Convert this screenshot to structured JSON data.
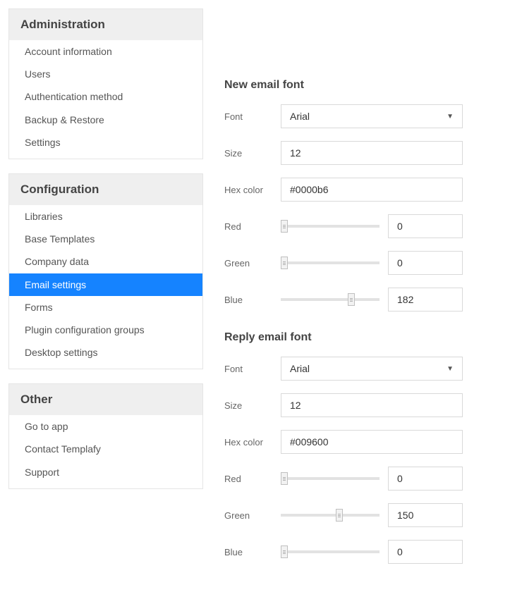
{
  "sidebar": {
    "groups": [
      {
        "header": "Administration",
        "items": [
          {
            "label": "Account information",
            "selected": false
          },
          {
            "label": "Users",
            "selected": false
          },
          {
            "label": "Authentication method",
            "selected": false
          },
          {
            "label": "Backup & Restore",
            "selected": false
          },
          {
            "label": "Settings",
            "selected": false
          }
        ]
      },
      {
        "header": "Configuration",
        "items": [
          {
            "label": "Libraries",
            "selected": false
          },
          {
            "label": "Base Templates",
            "selected": false
          },
          {
            "label": "Company data",
            "selected": false
          },
          {
            "label": "Email settings",
            "selected": true
          },
          {
            "label": "Forms",
            "selected": false
          },
          {
            "label": "Plugin configuration groups",
            "selected": false
          },
          {
            "label": "Desktop settings",
            "selected": false
          }
        ]
      },
      {
        "header": "Other",
        "items": [
          {
            "label": "Go to app",
            "selected": false
          },
          {
            "label": "Contact Templafy",
            "selected": false
          },
          {
            "label": "Support",
            "selected": false
          }
        ]
      }
    ]
  },
  "labels": {
    "font": "Font",
    "size": "Size",
    "hexcolor": "Hex color",
    "red": "Red",
    "green": "Green",
    "blue": "Blue"
  },
  "sections": {
    "new": {
      "title": "New email font",
      "font": "Arial",
      "size": "12",
      "hex": "#0000b6",
      "red": "0",
      "green": "0",
      "blue": "182",
      "swatch": "#0000b6"
    },
    "reply": {
      "title": "Reply email font",
      "font": "Arial",
      "size": "12",
      "hex": "#009600",
      "red": "0",
      "green": "150",
      "blue": "0",
      "swatch": "#009600"
    }
  }
}
